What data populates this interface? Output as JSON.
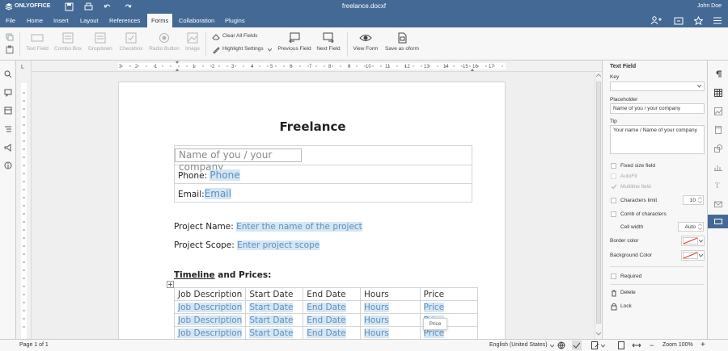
{
  "app": {
    "brand": "ONLYOFFICE",
    "filename": "freelance.docxf",
    "user": "John Doe"
  },
  "menu": {
    "tabs": [
      "File",
      "Home",
      "Insert",
      "Layout",
      "References",
      "Forms",
      "Collaboration",
      "Plugins"
    ],
    "active": "Forms"
  },
  "toolbar": {
    "text_field": "Text Field",
    "combo_box": "Combo Box",
    "dropdown": "Dropdown",
    "checkbox": "Checkbox",
    "radio_button": "Radio Button",
    "image": "Image",
    "clear_all": "Clear All Fields",
    "highlight": "Highlight Settings",
    "prev_field": "Previous Field",
    "next_field": "Next Field",
    "view_form": "View Form",
    "save_oform": "Save as oform"
  },
  "ruler": {
    "h_ticks": [
      "3",
      "2",
      "1",
      "1",
      "2",
      "3",
      "4",
      "5",
      "6",
      "7",
      "8",
      "9",
      "10",
      "11",
      "12",
      "13",
      "14",
      "15",
      "16",
      "17"
    ]
  },
  "doc": {
    "title": "Freelance",
    "name_ph": "Name of you / your company",
    "phone_label": "Phone:",
    "phone_ph": "Phone",
    "email_label": "Email:",
    "email_ph": "Email",
    "project_name_label": "Project Name:",
    "project_name_ph": "Enter the name of the project",
    "project_scope_label": "Project Scope:",
    "project_scope_ph": "Enter project scope",
    "timeline_heading": "Timeline",
    "timeline_and": " and Prices:",
    "table_headers": [
      "Job Description",
      "Start Date",
      "End Date",
      "Hours",
      "Price"
    ],
    "table_rows": [
      [
        "Job Description",
        "Start Date",
        "End Date",
        "Hours",
        "Price"
      ],
      [
        "Job Description",
        "Start Date",
        "End Date",
        "Hours",
        "Price"
      ],
      [
        "Job Description",
        "Start Date",
        "End Date",
        "Hours",
        "Price"
      ]
    ],
    "tooltip": "Price"
  },
  "panel": {
    "title": "Text Field",
    "key_label": "Key",
    "key_value": "",
    "placeholder_label": "Placeholder",
    "placeholder_value": "Name of you / your company",
    "tip_label": "Tip",
    "tip_value": "Your name / Name of your company",
    "fixed_size": "Fixed size field",
    "autofit": "AutoFit",
    "multiline": "Multiline field",
    "chars_limit": "Characters limit",
    "chars_value": "10",
    "comb": "Comb of characters",
    "cell_width": "Cell width",
    "cell_value": "Auto",
    "border_color": "Border color",
    "bg_color": "Background Color",
    "required": "Required",
    "delete": "Delete",
    "lock": "Lock"
  },
  "status": {
    "page": "Page 1 of 1",
    "language": "English (United States)",
    "zoom": "Zoom 100%"
  },
  "colors": {
    "header": "#446995",
    "placeholder_bg": "#d4e6f4",
    "placeholder_text": "#5f8fbf"
  }
}
